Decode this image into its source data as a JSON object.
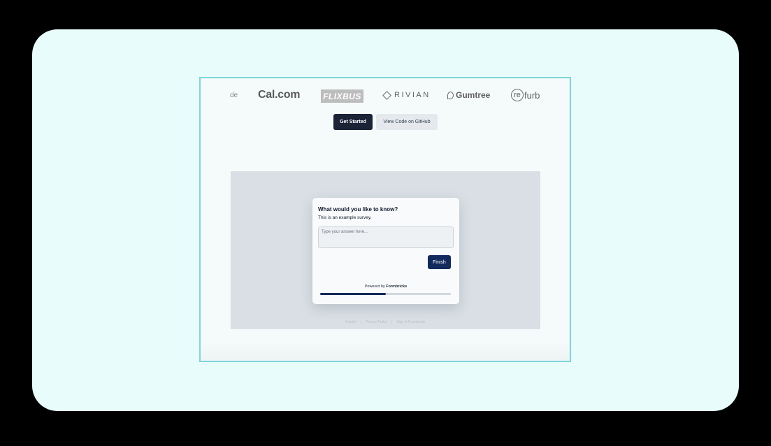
{
  "logos": {
    "partial": "de",
    "cal": "Cal.com",
    "flixbus": "FLIXBUS",
    "rivian": "RIVIAN",
    "gumtree": "Gumtree",
    "refurb_circle": "re",
    "refurb_rest": "furb"
  },
  "actions": {
    "get_started": "Get Started",
    "view_code": "View Code on GitHub"
  },
  "survey": {
    "title": "What would you like to know?",
    "subtitle": "This is an example survey.",
    "placeholder": "Type your answer here...",
    "value": "",
    "finish_label": "Finish",
    "powered_by_prefix": "Powered by",
    "powered_by_brand": "Formbricks",
    "progress": 0.5
  },
  "footer_links": [
    "Imprint",
    "Privacy Policy",
    "Sign in Formbricks"
  ],
  "colors": {
    "background": "#000000",
    "card": "#e9fcfc",
    "frame_border": "#7fd6da",
    "primary_dark": "#1b2437",
    "survey_brand": "#12295b"
  }
}
